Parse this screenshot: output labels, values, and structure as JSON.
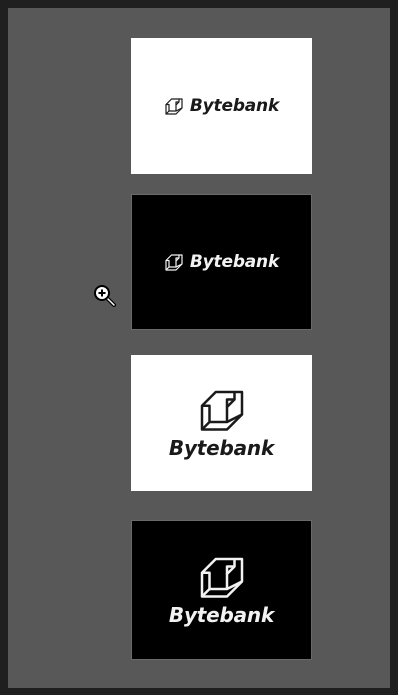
{
  "viewer": {
    "background": "#585858",
    "cursor_icon": "zoom-in-cursor-icon"
  },
  "logos": [
    {
      "variant": "horizontal-light",
      "icon": "bytebank-cube-logo-icon",
      "brand": "Bytebank",
      "background": "#ffffff",
      "foreground": "#1a1a1a"
    },
    {
      "variant": "horizontal-dark",
      "icon": "bytebank-cube-logo-icon",
      "brand": "Bytebank",
      "background": "#000000",
      "foreground": "#f2f2f2"
    },
    {
      "variant": "stacked-light",
      "icon": "bytebank-cube-logo-icon",
      "brand": "Bytebank",
      "background": "#ffffff",
      "foreground": "#1a1a1a"
    },
    {
      "variant": "stacked-dark",
      "icon": "bytebank-cube-logo-icon",
      "brand": "Bytebank",
      "background": "#000000",
      "foreground": "#f2f2f2"
    }
  ]
}
